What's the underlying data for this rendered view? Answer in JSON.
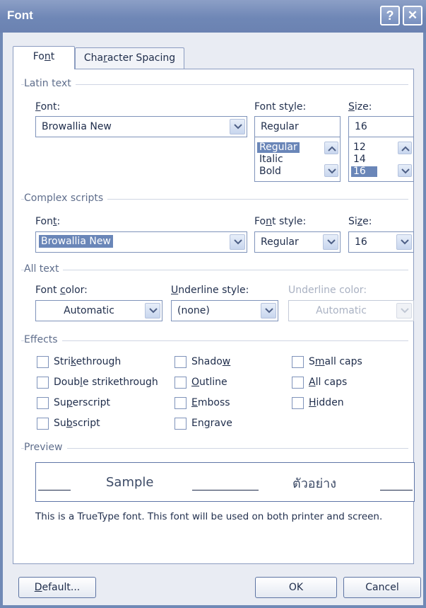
{
  "window": {
    "title": "Font"
  },
  "titlebar": {
    "help_glyph": "?",
    "close_glyph": "✕"
  },
  "tabs": [
    {
      "label": "Font",
      "underline_index": 2
    },
    {
      "label": "Character Spacing"
    }
  ],
  "latin": {
    "group_title": "Latin text",
    "font_label": "Font:",
    "font_value": "Browallia New",
    "style_label": "Font style:",
    "style_value": "Regular",
    "style_options": [
      "Regular",
      "Italic",
      "Bold"
    ],
    "size_label": "Size:",
    "size_value": "16",
    "size_options": [
      "12",
      "14",
      "16"
    ]
  },
  "complex": {
    "group_title": "Complex scripts",
    "font_label": "Font:",
    "font_value": "Browallia New",
    "style_label": "Font style:",
    "style_value": "Regular",
    "size_label": "Size:",
    "size_value": "16"
  },
  "all_text": {
    "group_title": "All text",
    "color_label": "Font color:",
    "color_value": "Automatic",
    "underline_label": "Underline style:",
    "underline_value": "(none)",
    "underline_color_label": "Underline color:",
    "underline_color_value": "Automatic"
  },
  "effects": {
    "group_title": "Effects",
    "col1": [
      "Strikethrough",
      "Double strikethrough",
      "Superscript",
      "Subscript"
    ],
    "col2": [
      "Shadow",
      "Outline",
      "Emboss",
      "Engrave"
    ],
    "col3": [
      "Small caps",
      "All caps",
      "Hidden"
    ]
  },
  "preview": {
    "group_title": "Preview",
    "latin_sample": "Sample",
    "complex_sample": "ตัวอย่าง",
    "note": "This is a TrueType font. This font will be used on both printer and screen."
  },
  "buttons": {
    "default": "Default...",
    "ok": "OK",
    "cancel": "Cancel"
  },
  "colors": {
    "titlebar": "#7089b6",
    "selection": "#6a86b8",
    "dialog_bg": "#e9ecf3"
  }
}
